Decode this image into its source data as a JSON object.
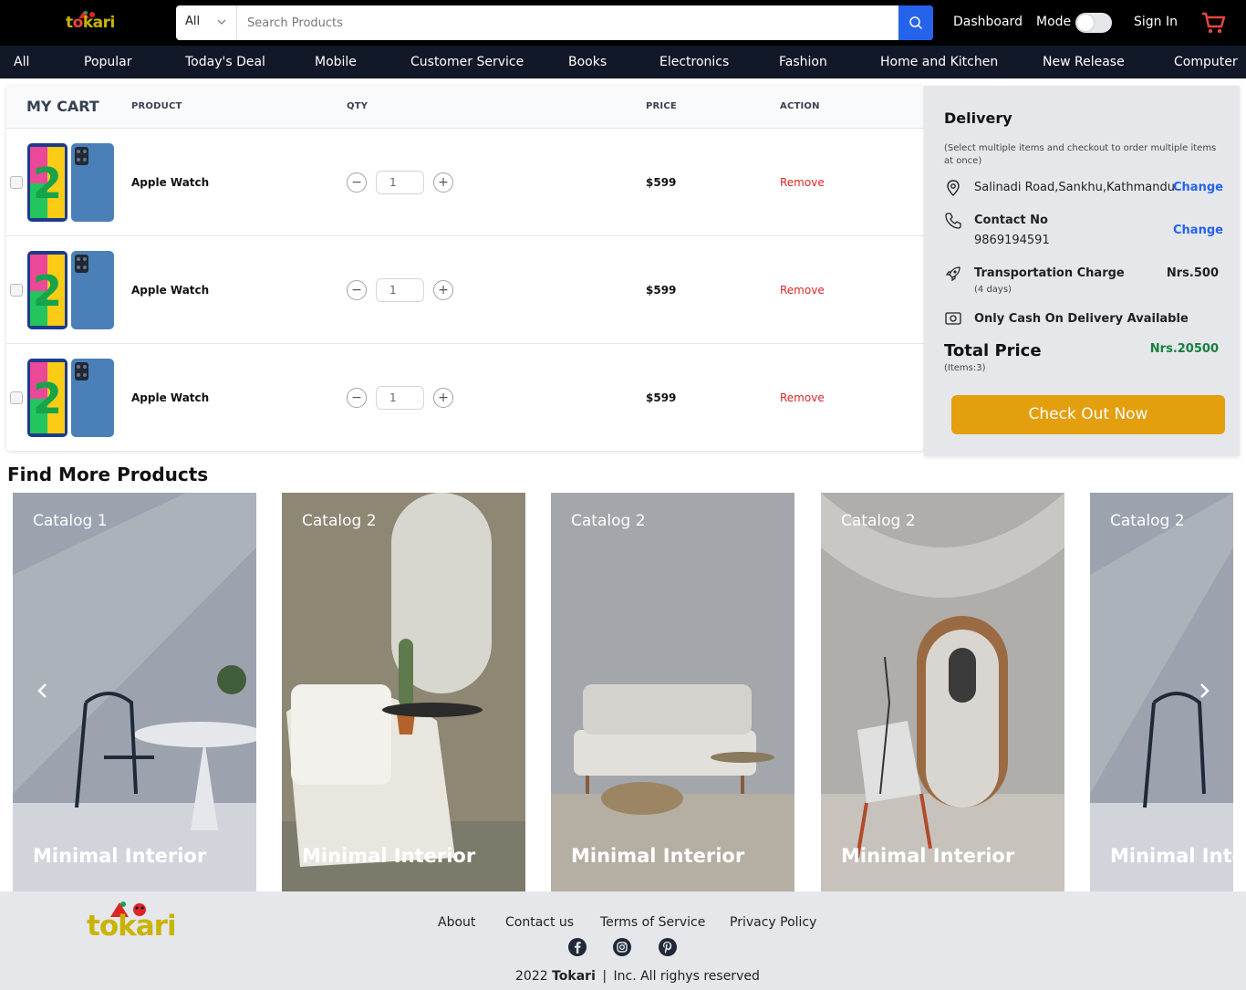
{
  "brand": {
    "name_pre": "t",
    "name_o": "o",
    "name_post": "kari",
    "footer_name": "tokari"
  },
  "search": {
    "category": "All",
    "placeholder": "Search Products"
  },
  "header": {
    "dashboard": "Dashboard",
    "mode": "Mode",
    "signin": "Sign In"
  },
  "categories": [
    "All",
    "Popular",
    "Today's Deal",
    "Mobile",
    "Customer Service",
    "Books",
    "Electronics",
    "Fashion",
    "Home and Kitchen",
    "New Release",
    "Computer"
  ],
  "cart": {
    "title": "MY CART",
    "columns": {
      "product": "PRODUCT",
      "qty": "QTY",
      "price": "PRICE",
      "action": "ACTION"
    },
    "items": [
      {
        "name": "Apple Watch",
        "qty": "1",
        "price": "$599",
        "action": "Remove"
      },
      {
        "name": "Apple Watch",
        "qty": "1",
        "price": "$599",
        "action": "Remove"
      },
      {
        "name": "Apple Watch",
        "qty": "1",
        "price": "$599",
        "action": "Remove"
      }
    ]
  },
  "delivery": {
    "title": "Delivery",
    "note": "(Select multiple items and checkout to order multiple items at once)",
    "address": "Salinadi Road,Sankhu,Kathmandu",
    "change": "Change",
    "contact_label": "Contact No",
    "contact_number": "9869194591",
    "transport_label": "Transportation Charge",
    "transport_days": "(4 days)",
    "transport_charge": "Nrs.500",
    "cod": "Only Cash On Delivery Available",
    "total_label": "Total Price",
    "total_items": "(Items:3)",
    "total_value": "Nrs.20500",
    "checkout": "Check Out Now"
  },
  "find_more": {
    "title": "Find More Products",
    "cards": [
      {
        "catalog": "Catalog 1",
        "caption": "Minimal Interior"
      },
      {
        "catalog": "Catalog 2",
        "caption": "Minimal Interior"
      },
      {
        "catalog": "Catalog 2",
        "caption": "Minimal Interior"
      },
      {
        "catalog": "Catalog 2",
        "caption": "Minimal Interior"
      },
      {
        "catalog": "Catalog 2",
        "caption": "Minimal Interior"
      }
    ]
  },
  "footer": {
    "links": [
      "About",
      "Contact us",
      "Terms of Service",
      "Privacy Policy"
    ],
    "copyright_year": "2022",
    "copyright_brand": "Tokari",
    "copyright_rest": "Inc. All righys reserved"
  },
  "colors": {
    "accent": "#2563eb",
    "checkout": "#e39f0d",
    "remove": "#dc2626",
    "total": "#15803d"
  }
}
